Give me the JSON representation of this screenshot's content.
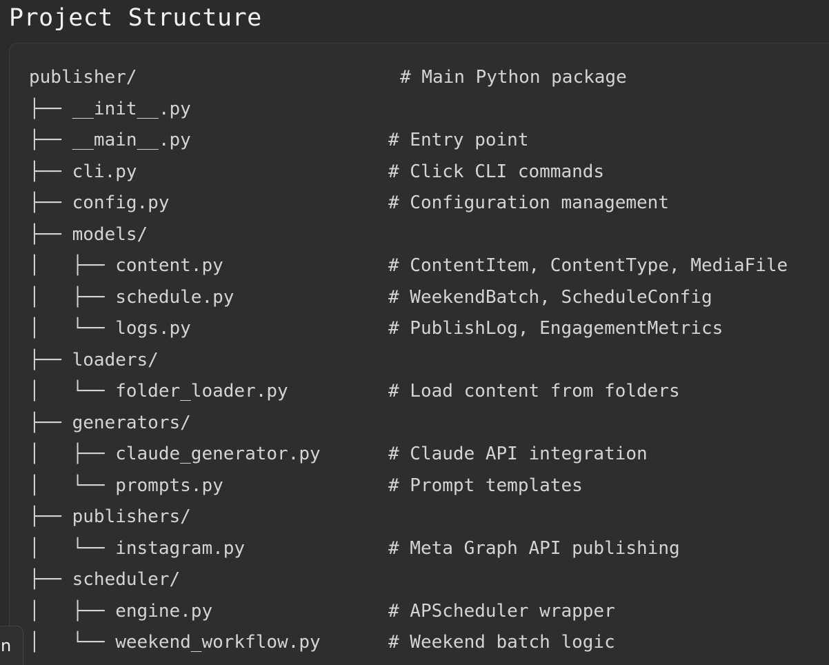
{
  "page": {
    "title": "Project Structure"
  },
  "tree": {
    "lines": [
      {
        "text": "publisher/",
        "comment": "# Main Python package"
      },
      {
        "text": "├── __init__.py",
        "comment": ""
      },
      {
        "text": "├── __main__.py",
        "comment": "# Entry point"
      },
      {
        "text": "├── cli.py",
        "comment": "# Click CLI commands"
      },
      {
        "text": "├── config.py",
        "comment": "# Configuration management"
      },
      {
        "text": "├── models/",
        "comment": ""
      },
      {
        "text": "│   ├── content.py",
        "comment": "# ContentItem, ContentType, MediaFile"
      },
      {
        "text": "│   ├── schedule.py",
        "comment": "# WeekendBatch, ScheduleConfig"
      },
      {
        "text": "│   └── logs.py",
        "comment": "# PublishLog, EngagementMetrics"
      },
      {
        "text": "├── loaders/",
        "comment": ""
      },
      {
        "text": "│   └── folder_loader.py",
        "comment": "# Load content from folders"
      },
      {
        "text": "├── generators/",
        "comment": ""
      },
      {
        "text": "│   ├── claude_generator.py",
        "comment": "# Claude API integration"
      },
      {
        "text": "│   └── prompts.py",
        "comment": "# Prompt templates"
      },
      {
        "text": "├── publishers/",
        "comment": ""
      },
      {
        "text": "│   └── instagram.py",
        "comment": "# Meta Graph API publishing"
      },
      {
        "text": "├── scheduler/",
        "comment": ""
      },
      {
        "text": "│   ├── engine.py",
        "comment": "# APScheduler wrapper"
      },
      {
        "text": "│   └── weekend_workflow.py",
        "comment": "# Weekend batch logic"
      }
    ]
  },
  "side_tab": {
    "label": "n"
  }
}
